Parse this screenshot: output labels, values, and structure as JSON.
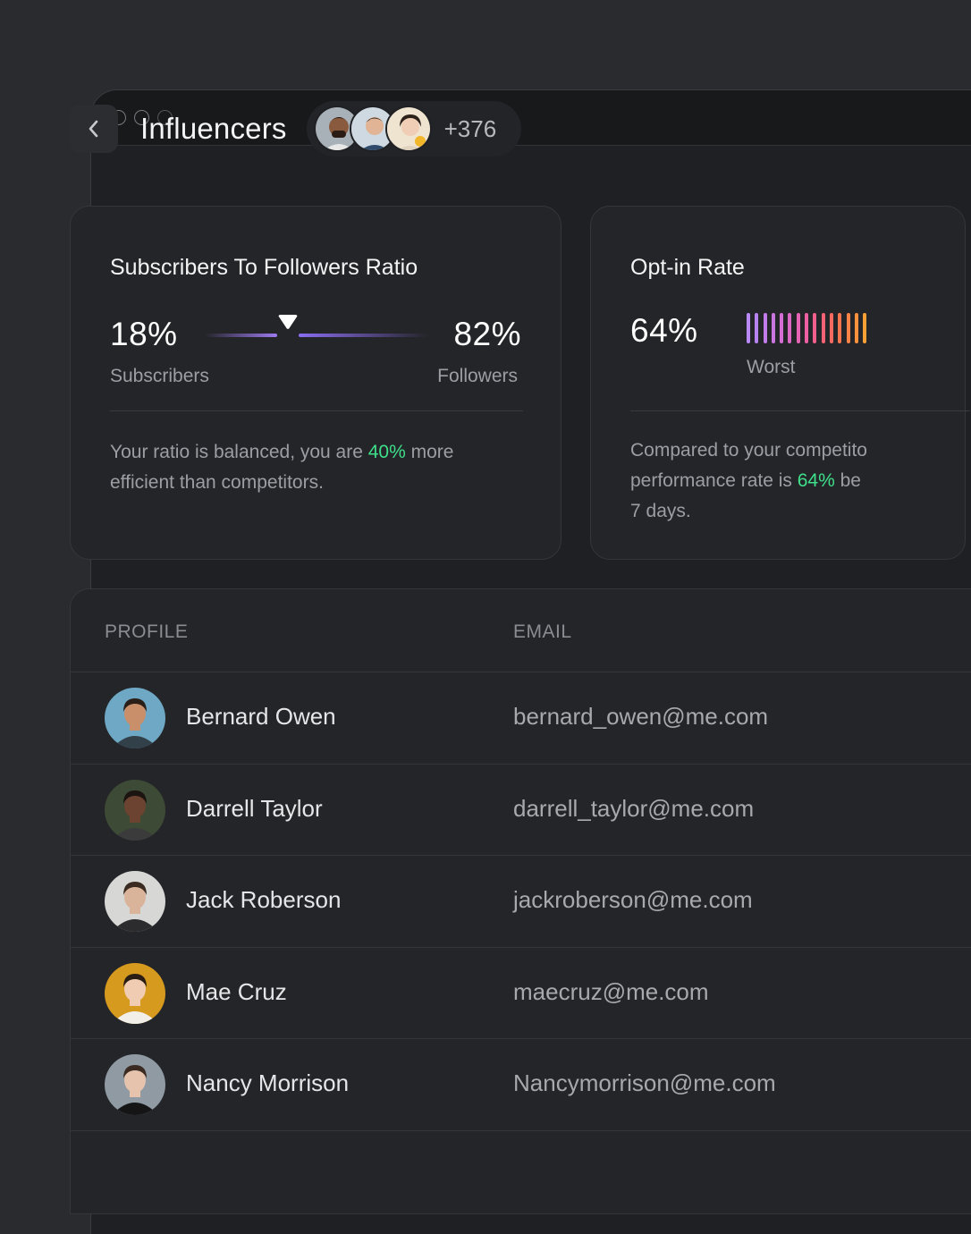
{
  "header": {
    "title": "Influencers",
    "avatar_count": "+376"
  },
  "ratio_card": {
    "title": "Subscribers To Followers Ratio",
    "left_value": "18%",
    "left_label": "Subscribers",
    "right_value": "82%",
    "right_label": "Followers",
    "slider_fraction": 0.37,
    "desc_before": "Your ratio is balanced, you are ",
    "desc_highlight": "40%",
    "desc_after": " more",
    "desc_line2": "efficient than competitors."
  },
  "optin_card": {
    "title": "Opt-in Rate",
    "value": "64%",
    "scale_label": "Worst",
    "desc_line1": "Compared to your competito",
    "desc_before": "performance rate is ",
    "desc_highlight": "64%",
    "desc_after": " be",
    "desc_line3": "7 days.",
    "bar_colors": [
      "#b98af7",
      "#b783f1",
      "#c27bea",
      "#cb75e1",
      "#d46ed4",
      "#dc68c6",
      "#e564b4",
      "#ec60a2",
      "#f25f8c",
      "#f56276",
      "#f76a62",
      "#f8764f",
      "#f98346",
      "#f9913d",
      "#f9a035"
    ]
  },
  "table": {
    "col_profile": "PROFILE",
    "col_email": "EMAIL",
    "rows": [
      {
        "name": "Bernard Owen",
        "email": "bernard_owen@me.com",
        "bg": "#6fa8c4",
        "skin": "#c98f6b",
        "hair": "#2a1e18",
        "shirt": "#32404a"
      },
      {
        "name": "Darrell Taylor",
        "email": "darrell_taylor@me.com",
        "bg": "#3d4a35",
        "skin": "#6b4330",
        "hair": "#1c1410",
        "shirt": "#3b3b3b"
      },
      {
        "name": "Jack Roberson",
        "email": "jackroberson@me.com",
        "bg": "#d7d7d5",
        "skin": "#d9b39a",
        "hair": "#3a2b22",
        "shirt": "#2c2c2e"
      },
      {
        "name": "Mae Cruz",
        "email": "maecruz@me.com",
        "bg": "#d69a1e",
        "skin": "#f0cdb2",
        "hair": "#2a1d14",
        "shirt": "#f2efe8"
      },
      {
        "name": "Nancy Morrison",
        "email": "Nancymorrison@me.com",
        "bg": "#8f9aa3",
        "skin": "#e6c3ad",
        "hair": "#3a2a22",
        "shirt": "#151515"
      }
    ]
  }
}
